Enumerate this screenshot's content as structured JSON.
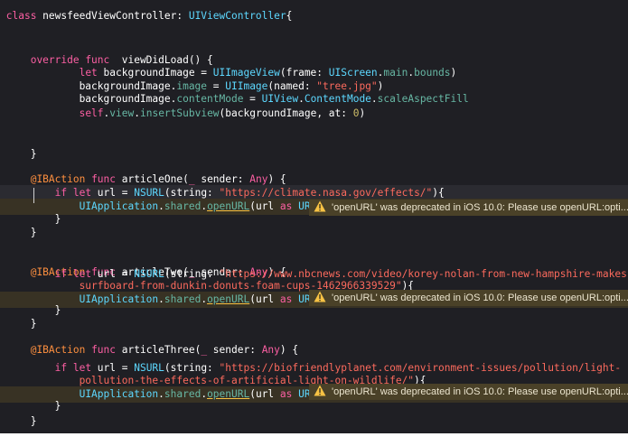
{
  "editor": {
    "theme_colors": {
      "background": "#1f1f24",
      "keyword": "#fc5fa3",
      "type": "#5dd8ff",
      "string": "#fc6a5d",
      "number": "#d0bf69",
      "attribute": "#fd8f3f",
      "property": "#67b7a4",
      "warning": "#f7c244"
    },
    "lines": [
      {
        "tokens": [
          [
            "kw",
            "class "
          ],
          [
            "pl",
            "newsfeedViewController: "
          ],
          [
            "ty",
            "UIViewController"
          ],
          [
            "pl",
            "{"
          ]
        ]
      },
      {
        "tokens": []
      },
      {
        "tokens": []
      },
      {
        "tokens": [
          [
            "pl",
            "    "
          ],
          [
            "kw",
            "override func "
          ],
          [
            "pl",
            " viewDidLoad() {"
          ]
        ]
      },
      {
        "tokens": [
          [
            "pl",
            "            "
          ],
          [
            "kw",
            "let "
          ],
          [
            "pl",
            "backgroundImage = "
          ],
          [
            "ty",
            "UIImageView"
          ],
          [
            "pl",
            "(frame: "
          ],
          [
            "ty",
            "UIScreen"
          ],
          [
            "pl",
            "."
          ],
          [
            "pr",
            "main"
          ],
          [
            "pl",
            "."
          ],
          [
            "pr",
            "bounds"
          ],
          [
            "pl",
            ")"
          ]
        ]
      },
      {
        "tokens": [
          [
            "pl",
            "            backgroundImage."
          ],
          [
            "pr",
            "image"
          ],
          [
            "pl",
            " = "
          ],
          [
            "ty",
            "UIImage"
          ],
          [
            "pl",
            "(named: "
          ],
          [
            "st",
            "\"tree.jpg\""
          ],
          [
            "pl",
            ")"
          ]
        ]
      },
      {
        "tokens": [
          [
            "pl",
            "            backgroundImage."
          ],
          [
            "pr",
            "contentMode"
          ],
          [
            "pl",
            " = "
          ],
          [
            "ty",
            "UIView"
          ],
          [
            "pl",
            "."
          ],
          [
            "ty",
            "ContentMode"
          ],
          [
            "pl",
            "."
          ],
          [
            "pr",
            "scaleAspectFill"
          ]
        ]
      },
      {
        "tokens": [
          [
            "pl",
            "            "
          ],
          [
            "kw",
            "self"
          ],
          [
            "pl",
            "."
          ],
          [
            "pr",
            "view"
          ],
          [
            "pl",
            "."
          ],
          [
            "pr",
            "insertSubview"
          ],
          [
            "pl",
            "(backgroundImage, at: "
          ],
          [
            "nu",
            "0"
          ],
          [
            "pl",
            ")"
          ]
        ]
      },
      {
        "tokens": []
      },
      {
        "tokens": []
      },
      {
        "tokens": [
          [
            "pl",
            "    }"
          ]
        ]
      },
      {
        "tokens": []
      },
      {
        "tokens": [
          [
            "pl",
            "    "
          ],
          [
            "at",
            "@IBAction "
          ],
          [
            "kw",
            "func "
          ],
          [
            "pl",
            "articleOne("
          ],
          [
            "kw",
            "_"
          ],
          [
            "pl",
            " sender: "
          ],
          [
            "kw",
            "Any"
          ],
          [
            "pl",
            ") {"
          ]
        ]
      },
      {
        "tokens": [
          [
            "pl",
            "        "
          ],
          [
            "kw",
            "if let "
          ],
          [
            "pl",
            "url = "
          ],
          [
            "ty",
            "NSURL"
          ],
          [
            "pl",
            "(string: "
          ],
          [
            "st",
            "\"https://climate.nasa.gov/effects/\""
          ],
          [
            "pl",
            "){"
          ]
        ]
      },
      {
        "tokens": [
          [
            "pl",
            "            "
          ],
          [
            "ty",
            "UIApplication"
          ],
          [
            "pl",
            "."
          ],
          [
            "pr",
            "shared"
          ],
          [
            "pl",
            "."
          ],
          [
            "ul",
            "openURL"
          ],
          [
            "pl",
            "(url "
          ],
          [
            "kw",
            "as "
          ],
          [
            "ty",
            "URL"
          ],
          [
            "pl",
            ")"
          ]
        ]
      },
      {
        "tokens": [
          [
            "pl",
            "        }"
          ]
        ]
      },
      {
        "tokens": [
          [
            "pl",
            "    }"
          ]
        ]
      },
      {
        "tokens": []
      },
      {
        "tokens": []
      },
      {
        "tokens": [
          [
            "pl",
            "    "
          ],
          [
            "at",
            "@IBAction "
          ],
          [
            "kw",
            "func "
          ],
          [
            "pl",
            "articleTwo("
          ],
          [
            "kw",
            "_"
          ],
          [
            "pl",
            " sender: "
          ],
          [
            "kw",
            "Any"
          ],
          [
            "pl",
            ") {"
          ]
        ]
      },
      {
        "tokens": [
          [
            "pl",
            "        "
          ],
          [
            "kw",
            "if let "
          ],
          [
            "pl",
            "url = "
          ],
          [
            "ty",
            "NSURL"
          ],
          [
            "pl",
            "(string: "
          ],
          [
            "st",
            "\"https://www.nbcnews.com/video/korey-nolan-from-new-hampshire-makes-"
          ]
        ]
      },
      {
        "tokens": [
          [
            "st",
            "            surfboard-from-dunkin-donuts-foam-cups-1462966339529\""
          ],
          [
            "pl",
            "){"
          ]
        ]
      },
      {
        "tokens": [
          [
            "pl",
            "            "
          ],
          [
            "ty",
            "UIApplication"
          ],
          [
            "pl",
            "."
          ],
          [
            "pr",
            "shared"
          ],
          [
            "pl",
            "."
          ],
          [
            "ul",
            "openURL"
          ],
          [
            "pl",
            "(url "
          ],
          [
            "kw",
            "as "
          ],
          [
            "ty",
            "URL"
          ],
          [
            "pl",
            ")"
          ]
        ]
      },
      {
        "tokens": [
          [
            "pl",
            "        }"
          ]
        ]
      },
      {
        "tokens": [
          [
            "pl",
            "    }"
          ]
        ]
      },
      {
        "tokens": []
      },
      {
        "tokens": []
      },
      {
        "tokens": [
          [
            "pl",
            "    "
          ],
          [
            "at",
            "@IBAction "
          ],
          [
            "kw",
            "func "
          ],
          [
            "pl",
            "articleThree("
          ],
          [
            "kw",
            "_"
          ],
          [
            "pl",
            " sender: "
          ],
          [
            "kw",
            "Any"
          ],
          [
            "pl",
            ") {"
          ]
        ]
      },
      {
        "tokens": [
          [
            "pl",
            "        "
          ],
          [
            "kw",
            "if let "
          ],
          [
            "pl",
            "url = "
          ],
          [
            "ty",
            "NSURL"
          ],
          [
            "pl",
            "(string: "
          ],
          [
            "st",
            "\"https://biofriendlyplanet.com/environment-issues/pollution/light-"
          ]
        ]
      },
      {
        "tokens": [
          [
            "st",
            "            pollution-the-effects-of-artificial-light-on-wildlife/\""
          ],
          [
            "pl",
            "){"
          ]
        ]
      },
      {
        "tokens": [
          [
            "pl",
            "            "
          ],
          [
            "ty",
            "UIApplication"
          ],
          [
            "pl",
            "."
          ],
          [
            "pr",
            "shared"
          ],
          [
            "pl",
            "."
          ],
          [
            "ul",
            "openURL"
          ],
          [
            "pl",
            "(url "
          ],
          [
            "kw",
            "as "
          ],
          [
            "ty",
            "URL"
          ],
          [
            "pl",
            ")"
          ]
        ]
      },
      {
        "tokens": [
          [
            "pl",
            "        }"
          ]
        ]
      },
      {
        "tokens": [
          [
            "pl",
            "    }"
          ]
        ]
      }
    ],
    "warning_message": "'openURL' was deprecated in iOS 10.0: Please use openURL:opti..."
  }
}
